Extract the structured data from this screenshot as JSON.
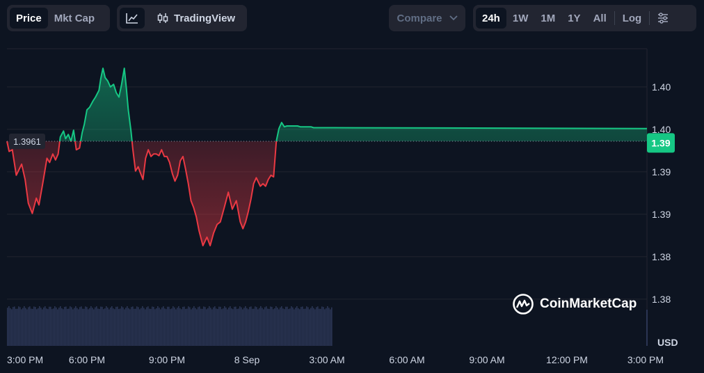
{
  "toolbar": {
    "metric_tabs": [
      {
        "label": "Price",
        "active": true
      },
      {
        "label": "Mkt Cap",
        "active": false
      }
    ],
    "line_chart_icon": "line-chart-icon",
    "tradingview_icon": "candlestick-icon",
    "tradingview_label": "TradingView",
    "compare_label": "Compare",
    "compare_icon": "chevron-down-icon",
    "ranges": [
      {
        "label": "24h",
        "active": true
      },
      {
        "label": "1W",
        "active": false
      },
      {
        "label": "1M",
        "active": false
      },
      {
        "label": "1Y",
        "active": false
      },
      {
        "label": "All",
        "active": false
      }
    ],
    "log_label": "Log",
    "settings_icon": "sliders-icon"
  },
  "watermark": {
    "text": "CoinMarketCap",
    "icon": "coinmarketcap-logo-icon"
  },
  "colors": {
    "up": "#16c784",
    "down": "#ea3943",
    "volume": "#2b3554",
    "grid": "#222531",
    "background": "#0d1421",
    "text": "#cfd6e4"
  },
  "chart_data": {
    "type": "line",
    "baseline_value": 1.3961,
    "baseline_label": "1.3961",
    "current_price_label": "1.39",
    "current_price": 1.3959,
    "currency_label": "USD",
    "y_ticks": [
      {
        "label": "1.38",
        "value": 1.3775
      },
      {
        "label": "1.38",
        "value": 1.3825
      },
      {
        "label": "1.39",
        "value": 1.3875
      },
      {
        "label": "1.39",
        "value": 1.3925
      },
      {
        "label": "1.40",
        "value": 1.3975
      },
      {
        "label": "1.40",
        "value": 1.4025
      }
    ],
    "ylim": [
      1.372,
      1.407
    ],
    "x_tick_labels": [
      "3:00 PM",
      "6:00 PM",
      "9:00 PM",
      "8 Sep",
      "3:00 AM",
      "6:00 AM",
      "9:00 AM",
      "12:00 PM",
      "3:00 PM"
    ],
    "x_ticks_hours": [
      0,
      3,
      6,
      9,
      12,
      15,
      18,
      21,
      24
    ],
    "price_hours": [
      0,
      0.08,
      0.2,
      0.35,
      0.55,
      0.68,
      0.8,
      0.95,
      1.1,
      1.2,
      1.35,
      1.5,
      1.6,
      1.72,
      1.82,
      1.92,
      2.0,
      2.12,
      2.2,
      2.3,
      2.4,
      2.5,
      2.6,
      2.72,
      2.82,
      2.9,
      3.0,
      3.1,
      3.22,
      3.32,
      3.45,
      3.52,
      3.6,
      3.68,
      3.78,
      3.88,
      4.0,
      4.1,
      4.2,
      4.3,
      4.4,
      4.48,
      4.55,
      4.65,
      4.72,
      4.82,
      4.92,
      5.0,
      5.1,
      5.2,
      5.3,
      5.4,
      5.5,
      5.6,
      5.7,
      5.8,
      5.9,
      6.0,
      6.1,
      6.2,
      6.3,
      6.4,
      6.5,
      6.6,
      6.7,
      6.8,
      6.9,
      7.0,
      7.1,
      7.2,
      7.35,
      7.5,
      7.62,
      7.75,
      7.88,
      8.0,
      8.15,
      8.3,
      8.45,
      8.6,
      8.75,
      8.85,
      8.95,
      9.05,
      9.15,
      9.25,
      9.35,
      9.5,
      9.6,
      9.7,
      9.8,
      9.9,
      10.0,
      10.1,
      10.2,
      10.3,
      10.4,
      10.5,
      10.6,
      10.7,
      10.8,
      10.9,
      11.0,
      11.1,
      11.2,
      11.3,
      11.4,
      11.5,
      11.6,
      11.7,
      11.8,
      11.95,
      12.1,
      12.25,
      24
    ],
    "price_values": [
      1.3961,
      1.3949,
      1.3951,
      1.3921,
      1.3934,
      1.3916,
      1.3888,
      1.3876,
      1.3894,
      1.3886,
      1.3913,
      1.3941,
      1.3936,
      1.3946,
      1.3939,
      1.3946,
      1.3966,
      1.3973,
      1.3964,
      1.3969,
      1.3961,
      1.3974,
      1.3951,
      1.3953,
      1.3971,
      1.3981,
      1.3998,
      1.4001,
      1.4008,
      1.4013,
      1.4021,
      1.4035,
      1.4047,
      1.4036,
      1.4032,
      1.4025,
      1.4028,
      1.4018,
      1.4013,
      1.4028,
      1.4047,
      1.4023,
      1.3998,
      1.3973,
      1.3952,
      1.3926,
      1.3931,
      1.3924,
      1.3916,
      1.3941,
      1.3951,
      1.3943,
      1.3946,
      1.3946,
      1.3944,
      1.3951,
      1.3943,
      1.3943,
      1.3936,
      1.3923,
      1.3914,
      1.3921,
      1.3938,
      1.3943,
      1.3928,
      1.3911,
      1.3891,
      1.3883,
      1.3872,
      1.3856,
      1.3838,
      1.3848,
      1.3838,
      1.3853,
      1.3863,
      1.3866,
      1.3883,
      1.3901,
      1.3881,
      1.3891,
      1.3866,
      1.3858,
      1.3866,
      1.3878,
      1.3893,
      1.3911,
      1.3918,
      1.3908,
      1.3911,
      1.3908,
      1.3916,
      1.3921,
      1.3919,
      1.3961,
      1.3976,
      1.3983,
      1.3978,
      1.3979,
      1.3979,
      1.3979,
      1.3979,
      1.3979,
      1.3978,
      1.3978,
      1.3978,
      1.3978,
      1.3978,
      1.3977,
      1.3977,
      1.3977,
      1.3977,
      1.3977,
      1.3977,
      1.3977,
      1.3976,
      1.3959
    ],
    "volume_hours_covered": [
      0,
      12.25
    ],
    "volume_level": 0.92
  }
}
